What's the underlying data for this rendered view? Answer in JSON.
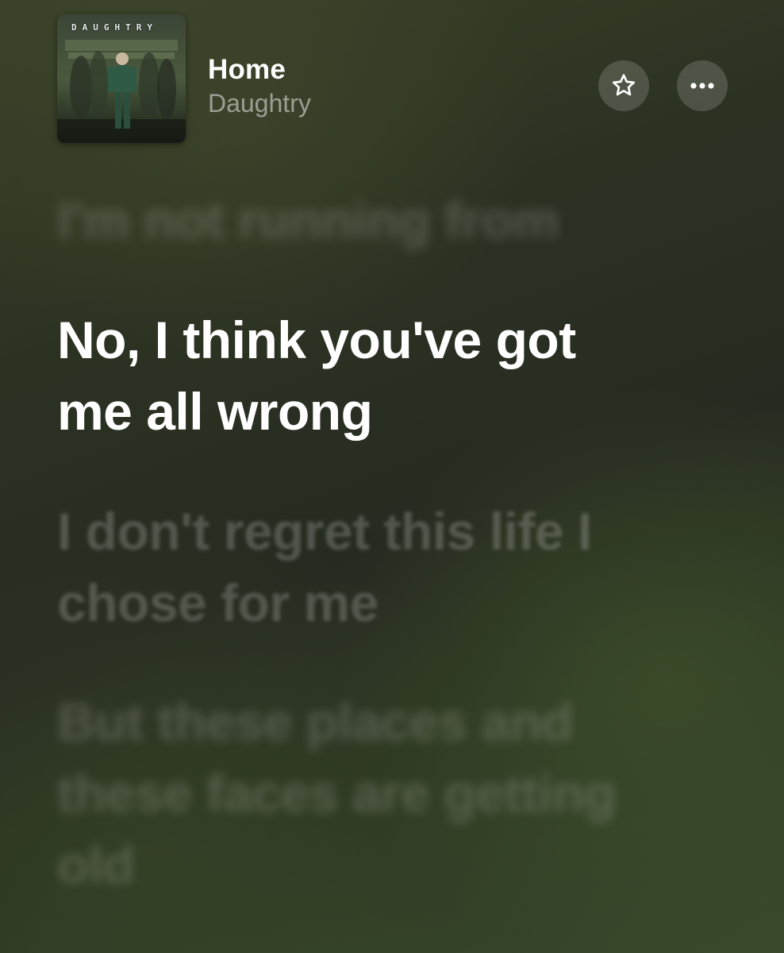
{
  "now_playing": {
    "album_cover": {
      "band_text": "DAUGHTRY",
      "icon": "album-art"
    },
    "title": "Home",
    "artist": "Daughtry"
  },
  "actions": {
    "favorite_icon": "star-icon",
    "more_icon": "ellipsis-icon"
  },
  "lyrics": {
    "previous": "I'm not running from",
    "current": "No, I think you've got me all wrong",
    "next": [
      "I don't regret this life I chose for me",
      "But these places and these faces are getting old"
    ]
  },
  "colors": {
    "background": "#2c3222",
    "active_lyric": "#ffffff",
    "button_fill": "rgba(255,255,255,0.16)"
  }
}
